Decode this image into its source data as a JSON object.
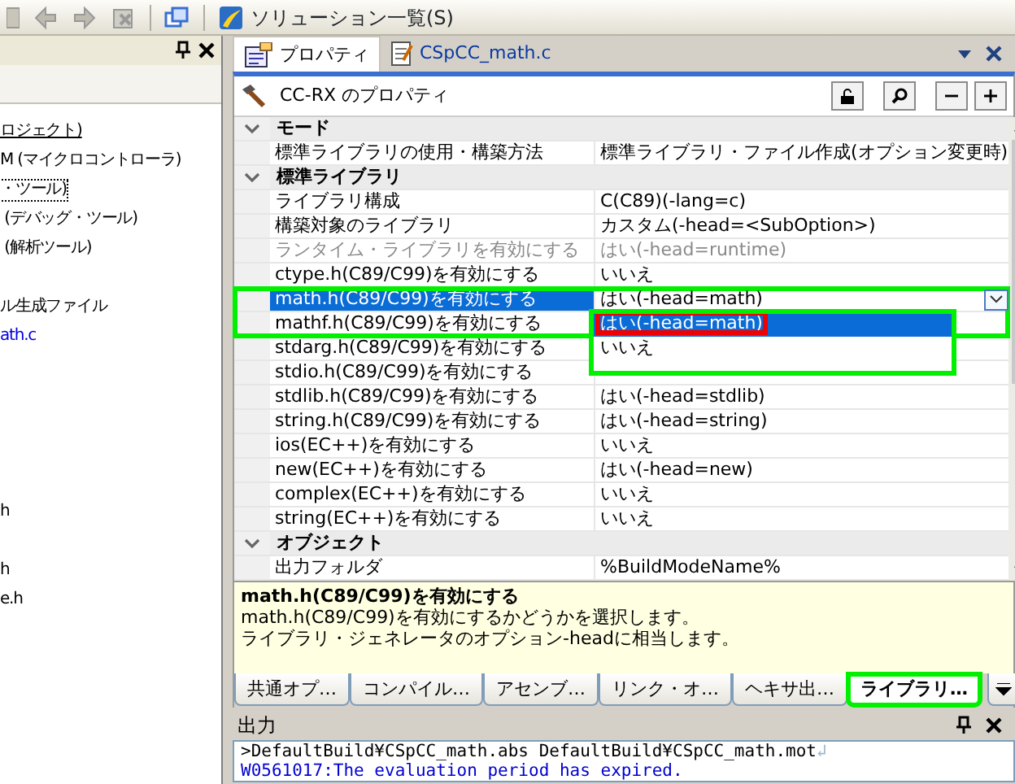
{
  "toolbar": {
    "solution_list": "ソリューション一覧(S)"
  },
  "project_tree": {
    "items": [
      {
        "kind": "node",
        "text": "ロジェクト)",
        "hovered": true,
        "focused": false
      },
      {
        "kind": "node",
        "text": "M (マイクロコントローラ)",
        "hovered": false,
        "focused": false
      },
      {
        "kind": "node",
        "text": "・ツール)",
        "hovered": false,
        "focused": true
      },
      {
        "kind": "node",
        "text": " (デバッグ・ツール)",
        "hovered": false,
        "focused": false
      },
      {
        "kind": "node",
        "text": " (解析ツール)",
        "hovered": false,
        "focused": false
      },
      {
        "kind": "blank"
      },
      {
        "kind": "node",
        "text": "ル生成ファイル",
        "hovered": false,
        "focused": false
      },
      {
        "kind": "file",
        "text": "ath.c",
        "hovered": false,
        "focused": false
      },
      {
        "kind": "blank"
      },
      {
        "kind": "blank"
      },
      {
        "kind": "blank"
      },
      {
        "kind": "blank"
      },
      {
        "kind": "blank"
      },
      {
        "kind": "node",
        "text": "h",
        "hovered": false,
        "focused": false
      },
      {
        "kind": "blank"
      },
      {
        "kind": "node",
        "text": "h",
        "hovered": false,
        "focused": false
      },
      {
        "kind": "node",
        "text": "e.h",
        "hovered": false,
        "focused": false
      }
    ]
  },
  "document_tabs": [
    {
      "label": "プロパティ",
      "selected": true,
      "kind": "properties"
    },
    {
      "label": "CSpCC_math.c",
      "selected": false,
      "kind": "file"
    }
  ],
  "properties": {
    "title": "CC-RX のプロパティ",
    "categories": [
      {
        "name": "モード",
        "expanded": true,
        "rows": [
          {
            "name": "標準ライブラリの使用・構築方法",
            "value": "標準ライブラリ・ファイル作成(オプション変更時)",
            "disabled": false,
            "selected": false,
            "annotated": false
          }
        ]
      },
      {
        "name": "標準ライブラリ",
        "expanded": true,
        "rows": [
          {
            "name": "ライブラリ構成",
            "value": "C(C89)(-lang=c)",
            "disabled": false,
            "selected": false,
            "annotated": false
          },
          {
            "name": "構築対象のライブラリ",
            "value": "カスタム(-head=<SubOption>)",
            "disabled": false,
            "selected": false,
            "annotated": false
          },
          {
            "name": "ランタイム・ライブラリを有効にする",
            "value": "はい(-head=runtime)",
            "disabled": true,
            "selected": false,
            "annotated": false
          },
          {
            "name": "ctype.h(C89/C99)を有効にする",
            "value": "いいえ",
            "disabled": false,
            "selected": false,
            "annotated": false
          },
          {
            "name": "math.h(C89/C99)を有効にする",
            "value": "はい(-head=math)",
            "disabled": false,
            "selected": true,
            "annotated": true,
            "dropdown": {
              "annotated": true,
              "options": [
                {
                  "text": "はい(-head=math)",
                  "selected": true,
                  "annotated": true
                },
                {
                  "text": "いいえ",
                  "selected": false,
                  "annotated": false
                }
              ]
            }
          },
          {
            "name": "mathf.h(C89/C99)を有効にする",
            "disabled": false,
            "selected": false,
            "annotated": true
          },
          {
            "name": "stdarg.h(C89/C99)を有効にする",
            "disabled": false,
            "selected": false,
            "annotated": false
          },
          {
            "name": "stdio.h(C89/C99)を有効にする",
            "disabled": false,
            "selected": false,
            "annotated": false
          },
          {
            "name": "stdlib.h(C89/C99)を有効にする",
            "value": "はい(-head=stdlib)",
            "disabled": false,
            "selected": false,
            "annotated": false
          },
          {
            "name": "string.h(C89/C99)を有効にする",
            "value": "はい(-head=string)",
            "disabled": false,
            "selected": false,
            "annotated": false
          },
          {
            "name": "ios(EC++)を有効にする",
            "value": "いいえ",
            "disabled": false,
            "selected": false,
            "annotated": false
          },
          {
            "name": "new(EC++)を有効にする",
            "value": "はい(-head=new)",
            "disabled": false,
            "selected": false,
            "annotated": false
          },
          {
            "name": "complex(EC++)を有効にする",
            "value": "いいえ",
            "disabled": false,
            "selected": false,
            "annotated": false
          },
          {
            "name": "string(EC++)を有効にする",
            "value": "いいえ",
            "disabled": false,
            "selected": false,
            "annotated": false
          }
        ]
      },
      {
        "name": "オブジェクト",
        "expanded": true,
        "rows": [
          {
            "name": "出力フォルダ",
            "value": "%BuildModeName%",
            "disabled": false,
            "selected": false,
            "annotated": false
          }
        ]
      }
    ],
    "description": {
      "title": "math.h(C89/C99)を有効にする",
      "lines": [
        "math.h(C89/C99)を有効にするかどうかを選択します。",
        "ライブラリ・ジェネレータのオプション-headに相当します。"
      ]
    },
    "tabs": [
      {
        "label": "共通オプ…",
        "selected": false,
        "annotated": false
      },
      {
        "label": "コンパイル…",
        "selected": false,
        "annotated": false
      },
      {
        "label": "アセンブ…",
        "selected": false,
        "annotated": false
      },
      {
        "label": "リンク・オ…",
        "selected": false,
        "annotated": false
      },
      {
        "label": "ヘキサ出…",
        "selected": false,
        "annotated": false
      },
      {
        "label": "ライブラリ…",
        "selected": true,
        "annotated": true
      }
    ]
  },
  "output": {
    "title": "出力",
    "lines": [
      {
        "kind": "command",
        "text": ">DefaultBuild¥CSpCC_math.abs DefaultBuild¥CSpCC_math.mot",
        "eol": "↲"
      },
      {
        "kind": "warning",
        "text": "W0561017:The evaluation period has expired."
      }
    ]
  }
}
